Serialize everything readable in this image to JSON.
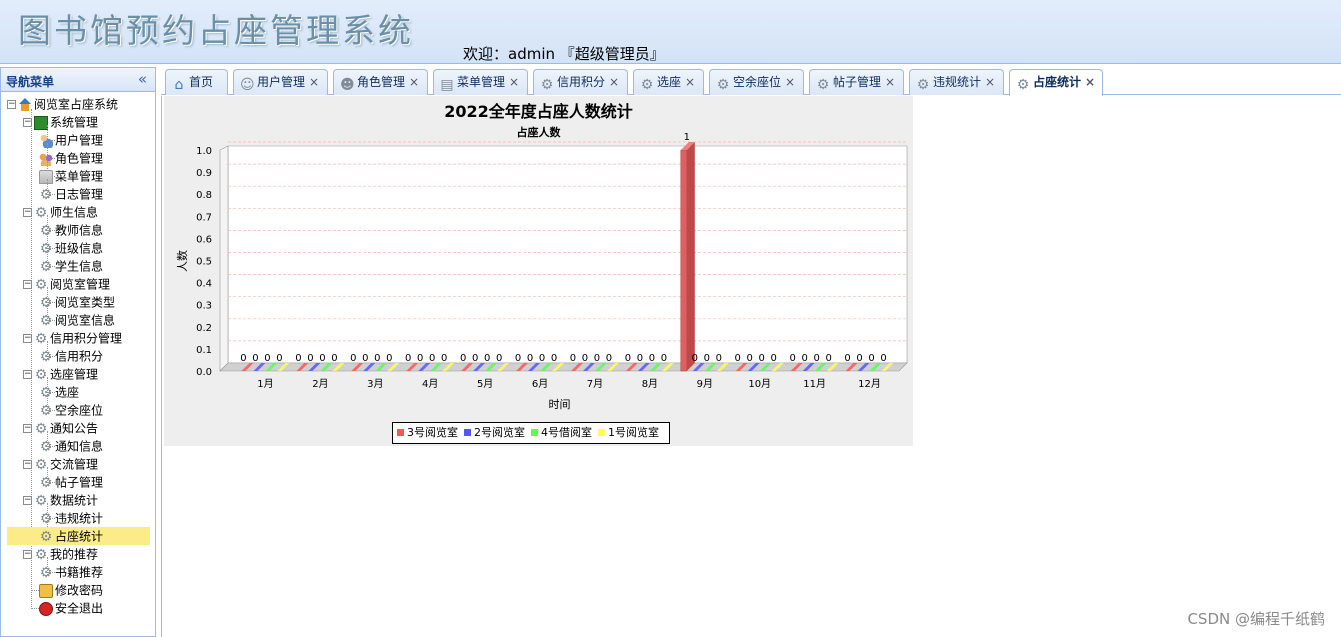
{
  "header": {
    "app_title": "图书馆预约占座管理系统",
    "welcome": "欢迎：admin 『超级管理员』"
  },
  "nav": {
    "title": "导航菜单",
    "collapse_icon": "«",
    "tree": [
      {
        "label": "阅览室占座系统",
        "icon": "home-icon",
        "level": 0
      },
      {
        "label": "系统管理",
        "icon": "system-icon",
        "level": 1
      },
      {
        "label": "用户管理",
        "icon": "user-icon",
        "level": 2
      },
      {
        "label": "角色管理",
        "icon": "role-icon",
        "level": 2
      },
      {
        "label": "菜单管理",
        "icon": "menu-icon",
        "level": 2
      },
      {
        "label": "日志管理",
        "icon": "gear-icon",
        "level": 2
      },
      {
        "label": "师生信息",
        "icon": "gear-icon",
        "level": 1
      },
      {
        "label": "教师信息",
        "icon": "gear-icon",
        "level": 2
      },
      {
        "label": "班级信息",
        "icon": "gear-icon",
        "level": 2
      },
      {
        "label": "学生信息",
        "icon": "gear-icon",
        "level": 2
      },
      {
        "label": "阅览室管理",
        "icon": "gear-icon",
        "level": 1
      },
      {
        "label": "阅览室类型",
        "icon": "gear-icon",
        "level": 2
      },
      {
        "label": "阅览室信息",
        "icon": "gear-icon",
        "level": 2
      },
      {
        "label": "信用积分管理",
        "icon": "gear-icon",
        "level": 1
      },
      {
        "label": "信用积分",
        "icon": "gear-icon",
        "level": 2
      },
      {
        "label": "选座管理",
        "icon": "gear-icon",
        "level": 1
      },
      {
        "label": "选座",
        "icon": "gear-icon",
        "level": 2
      },
      {
        "label": "空余座位",
        "icon": "gear-icon",
        "level": 2
      },
      {
        "label": "通知公告",
        "icon": "gear-icon",
        "level": 1
      },
      {
        "label": "通知信息",
        "icon": "gear-icon",
        "level": 2
      },
      {
        "label": "交流管理",
        "icon": "gear-icon",
        "level": 1
      },
      {
        "label": "帖子管理",
        "icon": "gear-icon",
        "level": 2
      },
      {
        "label": "数据统计",
        "icon": "gear-icon",
        "level": 1
      },
      {
        "label": "违规统计",
        "icon": "gear-icon",
        "level": 2
      },
      {
        "label": "占座统计",
        "icon": "gear-icon",
        "level": 2,
        "selected": true
      },
      {
        "label": "我的推荐",
        "icon": "gear-icon",
        "level": 1
      },
      {
        "label": "书籍推荐",
        "icon": "gear-icon",
        "level": 2
      },
      {
        "label": "修改密码",
        "icon": "key-icon",
        "level": 1
      },
      {
        "label": "安全退出",
        "icon": "exit-icon",
        "level": 1
      }
    ]
  },
  "tabs": [
    {
      "label": "首页",
      "icon": "home-icon",
      "closable": false
    },
    {
      "label": "用户管理",
      "icon": "user-icon",
      "closable": true
    },
    {
      "label": "角色管理",
      "icon": "role-icon",
      "closable": true
    },
    {
      "label": "菜单管理",
      "icon": "menu-icon",
      "closable": true
    },
    {
      "label": "信用积分",
      "icon": "gear-icon",
      "closable": true
    },
    {
      "label": "选座",
      "icon": "gear-icon",
      "closable": true
    },
    {
      "label": "空余座位",
      "icon": "gear-icon",
      "closable": true
    },
    {
      "label": "帖子管理",
      "icon": "gear-icon",
      "closable": true
    },
    {
      "label": "违规统计",
      "icon": "gear-icon",
      "closable": true
    },
    {
      "label": "占座统计",
      "icon": "gear-icon",
      "closable": true,
      "active": true
    }
  ],
  "tab_close_glyph": "×",
  "chart_data": {
    "type": "bar",
    "title": "2022全年度占座人数统计",
    "subtitle": "占座人数",
    "xlabel": "时间",
    "ylabel": "人数",
    "ylim": [
      0,
      1.0
    ],
    "yticks": [
      "0.0",
      "0.1",
      "0.2",
      "0.3",
      "0.4",
      "0.5",
      "0.6",
      "0.7",
      "0.8",
      "0.9",
      "1.0"
    ],
    "grid": true,
    "legend_placement": "bottom",
    "categories": [
      "1月",
      "2月",
      "3月",
      "4月",
      "5月",
      "6月",
      "7月",
      "8月",
      "9月",
      "10月",
      "11月",
      "12月"
    ],
    "series": [
      {
        "name": "3号阅览室",
        "color": "#ff5555",
        "values": [
          0,
          0,
          0,
          0,
          0,
          0,
          0,
          0,
          1,
          0,
          0,
          0
        ]
      },
      {
        "name": "2号阅览室",
        "color": "#5555ff",
        "values": [
          0,
          0,
          0,
          0,
          0,
          0,
          0,
          0,
          0,
          0,
          0,
          0
        ]
      },
      {
        "name": "4号借阅室",
        "color": "#55ff55",
        "values": [
          0,
          0,
          0,
          0,
          0,
          0,
          0,
          0,
          0,
          0,
          0,
          0
        ]
      },
      {
        "name": "1号阅览室",
        "color": "#ffff55",
        "values": [
          0,
          0,
          0,
          0,
          0,
          0,
          0,
          0,
          0,
          0,
          0,
          0
        ]
      }
    ]
  },
  "watermark": "CSDN @编程千纸鹤"
}
